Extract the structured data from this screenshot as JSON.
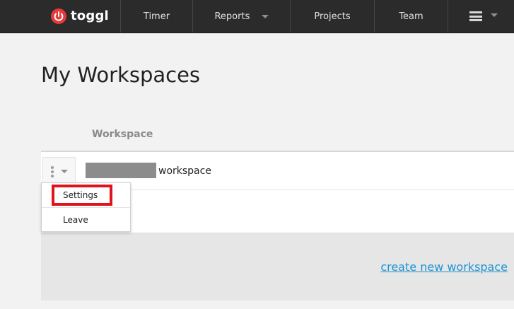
{
  "app": {
    "logo_text": "toggl",
    "brand_color": "#e63939",
    "logo_icon": "power-icon"
  },
  "nav": {
    "items": [
      {
        "label": "Timer"
      },
      {
        "label": "Reports",
        "has_caret": true
      },
      {
        "label": "Projects"
      },
      {
        "label": "Team"
      }
    ],
    "menu_icon": "hamburger-icon"
  },
  "page": {
    "title": "My Workspaces",
    "column_header": "Workspace"
  },
  "workspace_row": {
    "name_suffix": "workspace",
    "name_redacted": true,
    "menu_icon": "more-vertical-icon"
  },
  "dropdown": {
    "items": [
      {
        "label": "Settings",
        "highlighted": true
      },
      {
        "label": "Leave"
      }
    ]
  },
  "actions": {
    "create_link": "create new workspace",
    "link_color": "#1d93d2"
  },
  "annotation": {
    "highlight_color": "#e0141c"
  }
}
